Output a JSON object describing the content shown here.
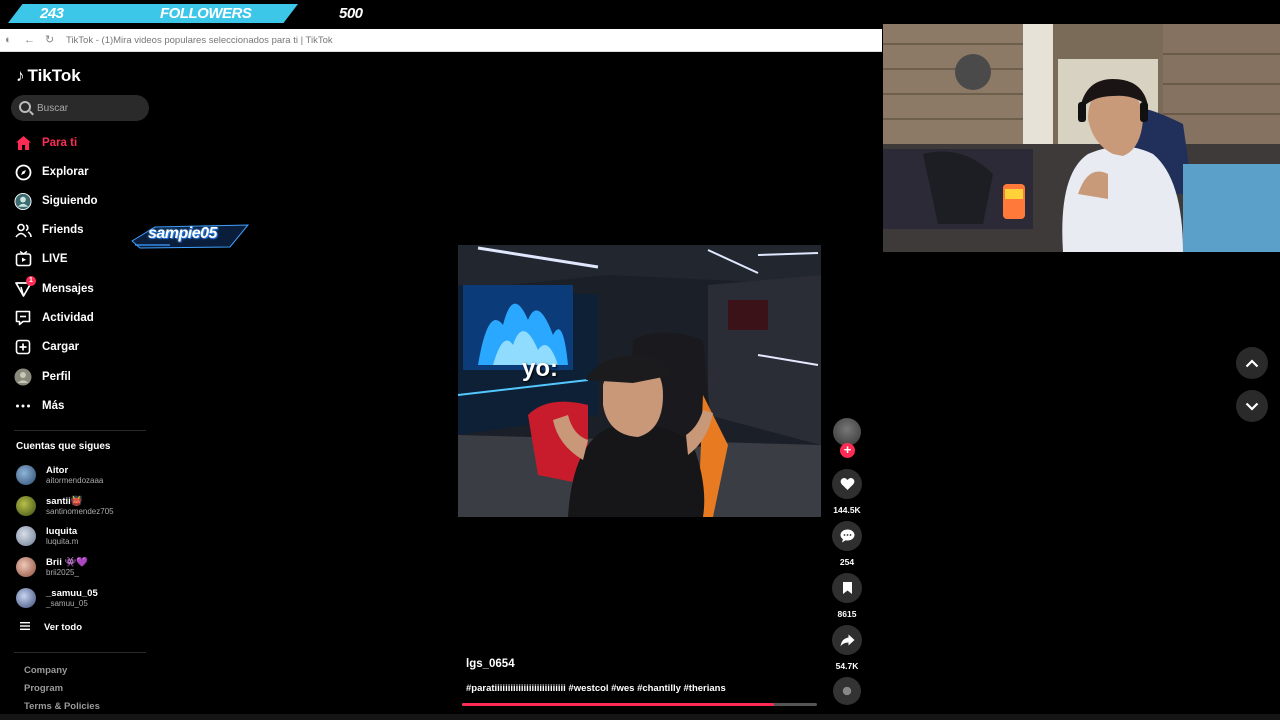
{
  "overlay": {
    "goal_current": "243",
    "goal_label": "FOLLOWERS",
    "goal_target": "500",
    "goal_progress": 0.486,
    "goal_color": "#3cc6e8"
  },
  "browser": {
    "url_text": "TikTok - (1)Mira videos populares seleccionados para ti | TikTok"
  },
  "sidebar": {
    "logo": "TikTok",
    "search_placeholder": "Buscar",
    "nav": [
      {
        "label": "Para ti",
        "icon": "home-icon",
        "active": true
      },
      {
        "label": "Explorar",
        "icon": "compass-icon"
      },
      {
        "label": "Siguiendo",
        "icon": "following-avatar-icon"
      },
      {
        "label": "Friends",
        "icon": "friends-icon"
      },
      {
        "label": "LIVE",
        "icon": "live-icon"
      },
      {
        "label": "Mensajes",
        "icon": "inbox-icon",
        "badge": "1"
      },
      {
        "label": "Actividad",
        "icon": "activity-icon"
      },
      {
        "label": "Cargar",
        "icon": "upload-icon"
      },
      {
        "label": "Perfil",
        "icon": "profile-avatar-icon"
      },
      {
        "label": "Más",
        "icon": "more-icon"
      }
    ],
    "following_title": "Cuentas que sigues",
    "accounts": [
      {
        "name": "Aitor",
        "handle": "aitormendozaaa"
      },
      {
        "name": "santii👹",
        "handle": "santinomendez705"
      },
      {
        "name": "luquita",
        "handle": "luquita.m"
      },
      {
        "name": "Brii 👾💜",
        "handle": "brii2025_"
      },
      {
        "name": "_samuu_05",
        "handle": "_samuu_05"
      }
    ],
    "see_all": "Ver todo",
    "footer": [
      "Company",
      "Program",
      "Terms & Policies"
    ]
  },
  "streamer_logo": "sampie05",
  "video": {
    "overlay_text": "yo:",
    "author": "lgs_0654",
    "hashtags": "#paratiiiiiiiiiiiiiiiiiiiiiiiiiii #westcol #wes #chantilly #therians",
    "progress": 0.88
  },
  "actions": {
    "likes": "144.5K",
    "comments": "254",
    "saves": "8615",
    "shares": "54.7K"
  },
  "colors": {
    "accent": "#fe2c55",
    "background": "#000000"
  }
}
